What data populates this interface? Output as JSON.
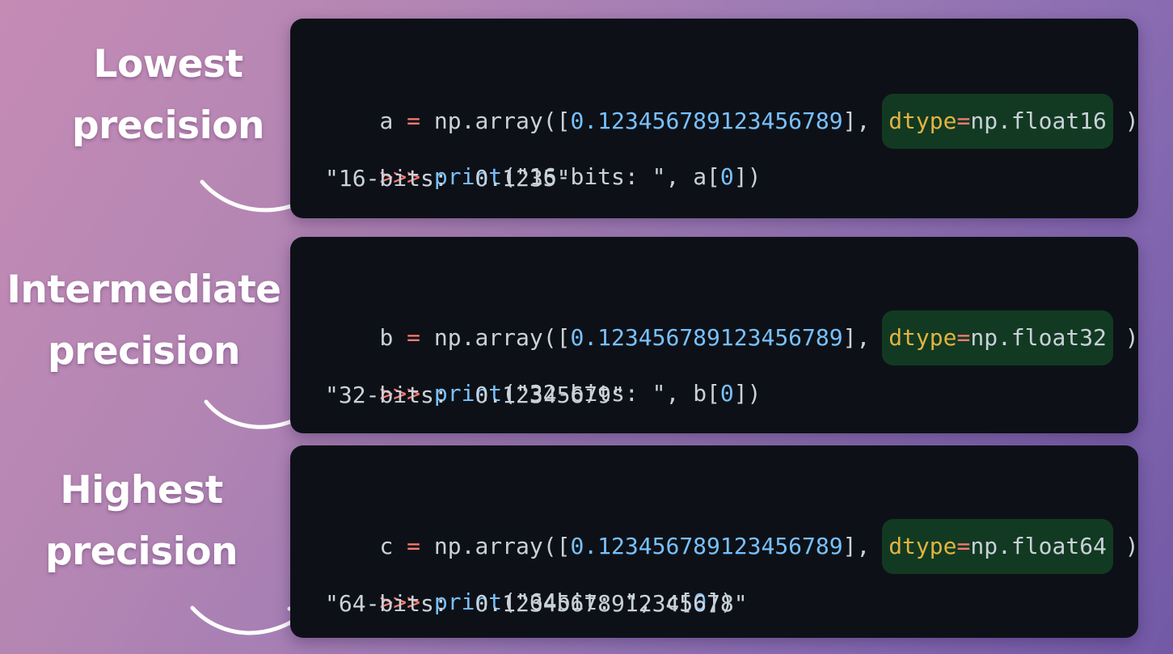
{
  "labels": {
    "lowest": [
      "Lowest",
      "precision"
    ],
    "intermediate": [
      "Intermediate",
      "precision"
    ],
    "highest": [
      "Highest",
      "precision"
    ]
  },
  "blocks": [
    {
      "var": "a",
      "assign_op": "=",
      "call_open": "np.array([",
      "value": "0.123456789123456789",
      "call_close": "],",
      "dtype_kw": "dtype",
      "dtype_eq": "=",
      "dtype_val": "np.float16",
      "paren_close": ")",
      "prompt": ">>>",
      "print_fn": "print",
      "print_open": "(",
      "print_str": "\"16-bits: \"",
      "print_sep": ", ",
      "print_var": "a[",
      "print_idx": "0",
      "print_close": "])",
      "output": "\"16-bits:  0.1235\""
    },
    {
      "var": "b",
      "assign_op": "=",
      "call_open": "np.array([",
      "value": "0.123456789123456789",
      "call_close": "],",
      "dtype_kw": "dtype",
      "dtype_eq": "=",
      "dtype_val": "np.float32",
      "paren_close": ")",
      "prompt": ">>>",
      "print_fn": "print",
      "print_open": "(",
      "print_str": "\"32-bits: \"",
      "print_sep": ", ",
      "print_var": "b[",
      "print_idx": "0",
      "print_close": "])",
      "output": "\"32-bits:  0.12345679\""
    },
    {
      "var": "c",
      "assign_op": "=",
      "call_open": "np.array([",
      "value": "0.123456789123456789",
      "call_close": "],",
      "dtype_kw": "dtype",
      "dtype_eq": "=",
      "dtype_val": "np.float64",
      "paren_close": ")",
      "prompt": ">>>",
      "print_fn": "print",
      "print_open": "(",
      "print_str": "\"64bit: \"",
      "print_sep": ", ",
      "print_var": "c[",
      "print_idx": "0",
      "print_close": "])",
      "output": "\"64-bits:  0.12345678912345678\""
    }
  ],
  "colors": {
    "panel_bg": "#0d1117",
    "highlight_bg": "#123a22",
    "operator": "#ff7b72",
    "number": "#79c0ff",
    "keyword": "#e3b341",
    "text": "#c9d1d9",
    "arrow": "#ffffff"
  },
  "icons": [
    "curved-arrow-icon"
  ]
}
